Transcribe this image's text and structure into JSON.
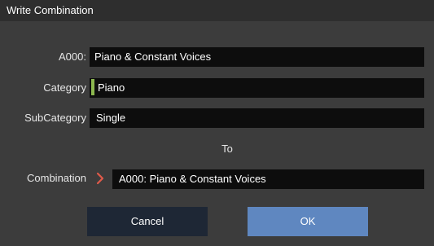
{
  "dialog": {
    "title": "Write Combination",
    "rows": {
      "name": {
        "label": "A000:",
        "value": "Piano & Constant Voices"
      },
      "category": {
        "label": "Category",
        "value": "Piano",
        "swatch_color": "#8cb84f"
      },
      "subcategory": {
        "label": "SubCategory",
        "value": "Single"
      },
      "to_label": "To",
      "destination": {
        "label": "Combination",
        "value": "A000: Piano & Constant Voices",
        "arrow_color": "#e05a4a"
      }
    },
    "buttons": {
      "cancel": "Cancel",
      "ok": "OK"
    }
  }
}
